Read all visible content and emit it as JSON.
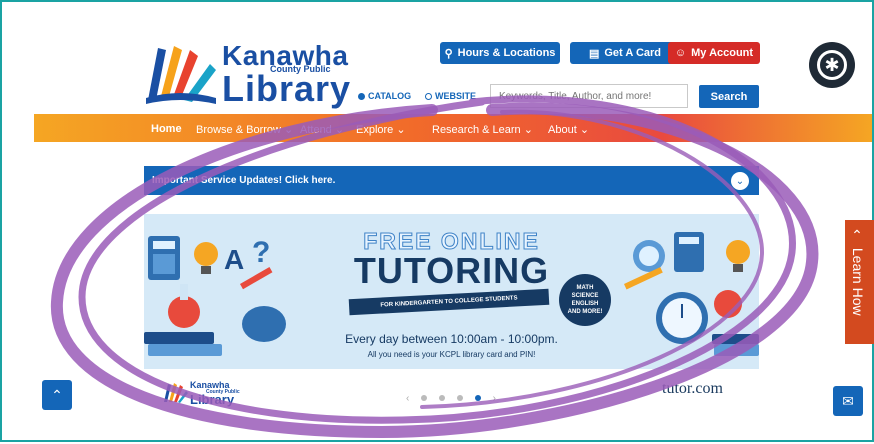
{
  "logo": {
    "word1": "Kanawha",
    "sub1": "County Public",
    "word2": "Library"
  },
  "top_buttons": {
    "hours": "Hours & Locations",
    "card": "Get A Card",
    "account": "My Account"
  },
  "search": {
    "catalog": "CATALOG",
    "website": "WEBSITE",
    "placeholder": "Keywords, Title, Author, and more!",
    "button": "Search"
  },
  "nav": [
    "Home",
    "Browse & Borrow",
    "Attend",
    "Explore",
    "Research & Learn",
    "About"
  ],
  "update_bar": "Important Service Updates! Click here.",
  "banner": {
    "title1": "FREE ONLINE",
    "title2": "TUTORING",
    "ribbon": "FOR KINDERGARTEN TO COLLEGE STUDENTS",
    "subjects": [
      "MATH",
      "SCIENCE",
      "ENGLISH",
      "AND MORE!"
    ],
    "line1": "Every day between 10:00am - 10:00pm.",
    "line2": "All you need is your KCPL library card and PIN!"
  },
  "bottom": {
    "logo_word1": "Kanawha",
    "logo_sub": "County Public",
    "logo_word2": "Library",
    "tutor": "tutor.com"
  },
  "learn_how": "Learn How",
  "carousel": {
    "pages": 5,
    "active": 4
  },
  "colors": {
    "blue": "#1466b8",
    "red": "#d52b27",
    "orange": "#f16b2a",
    "purple_annotation": "#9a5cb8"
  }
}
